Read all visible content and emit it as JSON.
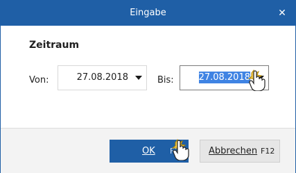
{
  "title": "Eingabe",
  "close_icon": "close-icon",
  "section_title": "Zeitraum",
  "from": {
    "label": "Von:",
    "value": "27.08.2018"
  },
  "to": {
    "label": "Bis:",
    "value": "27.08.2018"
  },
  "buttons": {
    "ok": {
      "label": "OK",
      "key": "F2"
    },
    "cancel": {
      "label": "Abbrechen",
      "key": "F12"
    }
  },
  "colors": {
    "accent": "#1f5fa6",
    "selection": "#3f83e3"
  }
}
